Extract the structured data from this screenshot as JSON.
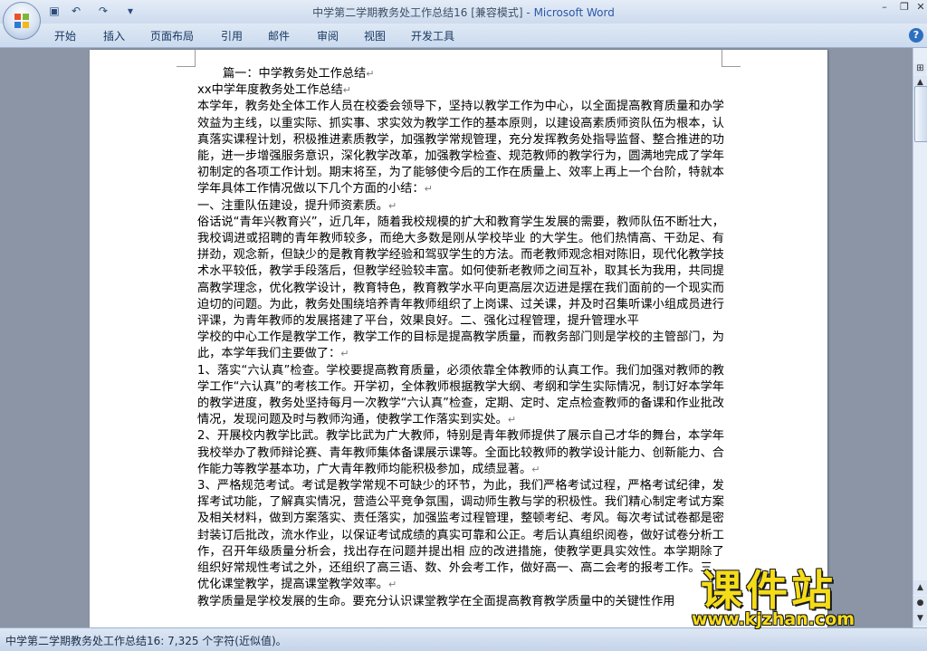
{
  "window": {
    "title": "中学第二学期教务处工作总结16 [兼容模式]",
    "title_app": " - Microsoft Word",
    "controls": [
      "minimize-icon",
      "restore-icon",
      "close-icon"
    ]
  },
  "quick_access": {
    "icons": [
      "save-icon",
      "undo-icon",
      "redo-icon",
      "customize-icon"
    ],
    "glyphs": [
      "▣",
      "↶",
      "↷",
      "▾"
    ]
  },
  "ribbon": {
    "tabs": [
      "开始",
      "插入",
      "页面布局",
      "引用",
      "邮件",
      "审阅",
      "视图",
      "开发工具"
    ],
    "help_glyph": "?"
  },
  "document": {
    "paragraphs": [
      "篇一：中学教务处工作总结",
      "xx中学年度教务处工作总结",
      "本学年，教务处全体工作人员在校委会领导下，坚持以教学工作为中心，以全面提高教育质量和办学效益为主线，以重实际、抓实事、求实效为教学工作的基本原则，以建设高素质师资队伍为根本，认真落实课程计划，积极推进素质教学，加强教学常规管理，充分发挥教务处指导监督、整合推进的功能，进一步增强服务意识，深化教学改革，加强教学检查、规范教师的教学行为，圆满地完成了学年初制定的各项工作计划。期末将至，为了能够使今后的工作在质量上、效率上再上一个台阶，特就本学年具体工作情况做以下几个方面的小结：",
      "一、注重队伍建设，提升师资素质。",
      "俗话说“青年兴教育兴”，近几年，随着我校规模的扩大和教育学生发展的需要，教师队伍不断壮大，我校调进或招聘的青年教师较多，而绝大多数是刚从学校毕业 的大学生。他们热情高、干劲足、有拼劲，观念新，但缺少的是教育教学经验和驾驭学生的方法。而老教师观念相对陈旧，现代化教学技术水平较低，教学手段落后，但教学经验较丰富。如何使新老教师之间互补，取其长为我用，共同提高教学理念，优化教学设计，教育特色，教育教学水平向更高层次迈进是摆在我们面前的一个现实而迫切的问题。为此，教务处围绕培养青年教师组织了上岗课、过关课，并及时召集听课小组成员进行评课，为青年教师的发展搭建了平台，效果良好。二、强化过程管理，提升管理水平",
      "学校的中心工作是教学工作，教学工作的目标是提高教学质量，而教务部门则是学校的主管部门，为此，本学年我们主要做了：",
      "1、落实“六认真”检查。学校要提高教育质量，必须依靠全体教师的认真工作。我们加强对教师的教学工作“六认真”的考核工作。开学初，全体教师根据教学大纲、考纲和学生实际情况，制订好本学年的教学进度，教务处坚持每月一次教学“六认真”检查，定期、定时、定点检查教师的备课和作业批改情况，发现问题及时与教师沟通，使教学工作落实到实处。",
      "2、开展校内教学比武。教学比武为广大教师，特别是青年教师提供了展示自己才华的舞台，本学年我校举办了教师辩论赛、青年教师集体备课展示课等。全面比较教师的教学设计能力、创新能力、合作能力等教学基本功，广大青年教师均能积极参加，成绩显著。",
      "3、严格规范考试。考试是教学常规不可缺少的环节，为此，我们严格考试过程，严格考试纪律，发挥考试功能，了解真实情况，营造公平竞争氛围，调动师生教与学的积极性。我们精心制定考试方案及相关材料，做到方案落实、责任落实，加强监考过程管理，整顿考纪、考风。每次考试试卷都是密封装订后批改，流水作业，以保证考试成绩的真实可靠和公正。考后认真组织阅卷，做好试卷分析工作，召开年级质量分析会，找出存在问题并提出相 应的改进措施，使教学更具实效性。本学期除了组织好常规性考试之外，还组织了高三语、数、外会考工作，做好高一、高二会考的报考工作。三、优化课堂教学，提高课堂教学效率。",
      "教学质量是学校发展的生命。要充分认识课堂教学在全面提高教育教学质量中的关键性作用"
    ],
    "paragraph_mark": "↵"
  },
  "scrollbar": {
    "up_glyph": "▲",
    "ruler_glyph": "⊞",
    "nav_glyphs": [
      "▲",
      "●",
      "▼"
    ]
  },
  "status_bar": {
    "text": "中学第二学期教务处工作总结16: 7,325 个字符(近似值)。"
  },
  "watermark": {
    "title": "课件站",
    "url": "www.kjzhan.com"
  }
}
